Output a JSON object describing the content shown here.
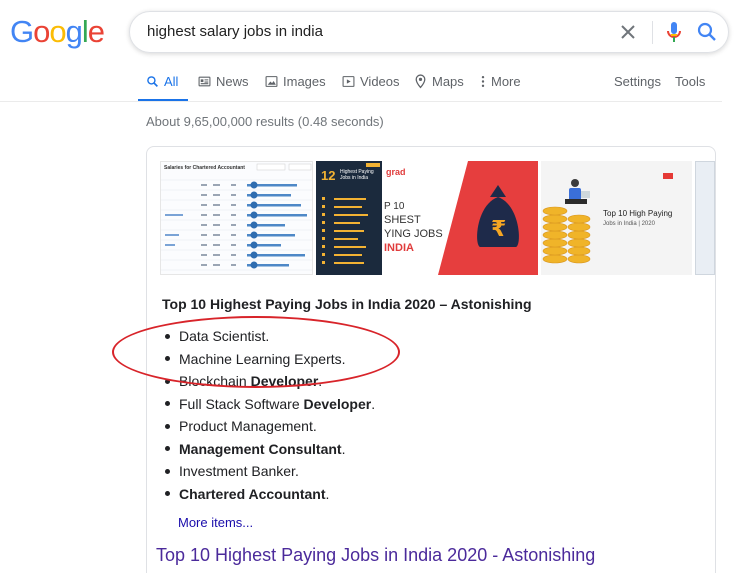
{
  "logo": {
    "letters": [
      "G",
      "o",
      "o",
      "g",
      "l",
      "e"
    ],
    "colors": [
      "#4285F4",
      "#EA4335",
      "#FBBC05",
      "#4285F4",
      "#34A853",
      "#EA4335"
    ]
  },
  "search": {
    "query": "highest salary jobs in india"
  },
  "tabs": [
    {
      "label": "All",
      "icon": "search-icon",
      "active": true
    },
    {
      "label": "News",
      "icon": "news-icon"
    },
    {
      "label": "Images",
      "icon": "image-icon"
    },
    {
      "label": "Videos",
      "icon": "video-icon"
    },
    {
      "label": "Maps",
      "icon": "map-pin-icon"
    },
    {
      "label": "More",
      "icon": "more-vert-icon"
    }
  ],
  "tools": {
    "settings": "Settings",
    "tools": "Tools"
  },
  "results_stats": "About 9,65,00,000 results (0.48 seconds)",
  "images": {
    "thumb1_title": "Salaries for Chartered Accountant",
    "thumb2_heading": "12",
    "thumb2_text": "Highest Paying Jobs in India",
    "thumb3_brand": "grad",
    "thumb3_lines": [
      "P 10",
      "SHEST",
      "YING JOBS",
      "INDIA"
    ],
    "thumb4_title": "Top 10 High Paying",
    "thumb4_sub": "Jobs in India | 2020"
  },
  "snippet": {
    "title": "Top 10 Highest Paying Jobs in India 2020 – Astonishing",
    "items": [
      {
        "normal": "Data Scientist.",
        "bold": "",
        "suffix": ""
      },
      {
        "normal": "Machine Learning Experts.",
        "bold": "",
        "suffix": ""
      },
      {
        "normal": "Blockchain ",
        "bold": "Developer",
        "suffix": "."
      },
      {
        "normal": "Full Stack Software ",
        "bold": "Developer",
        "suffix": "."
      },
      {
        "normal": "Product Management.",
        "bold": "",
        "suffix": ""
      },
      {
        "normal": "",
        "bold": "Management Consultant",
        "suffix": "."
      },
      {
        "normal": "Investment Banker.",
        "bold": "",
        "suffix": ""
      },
      {
        "normal": "",
        "bold": "Chartered Accountant",
        "suffix": "."
      }
    ],
    "more_items": "More items..."
  },
  "result": {
    "title": "Top 10 Highest Paying Jobs in India 2020 - Astonishing"
  },
  "annotation_color": "#d8242a"
}
